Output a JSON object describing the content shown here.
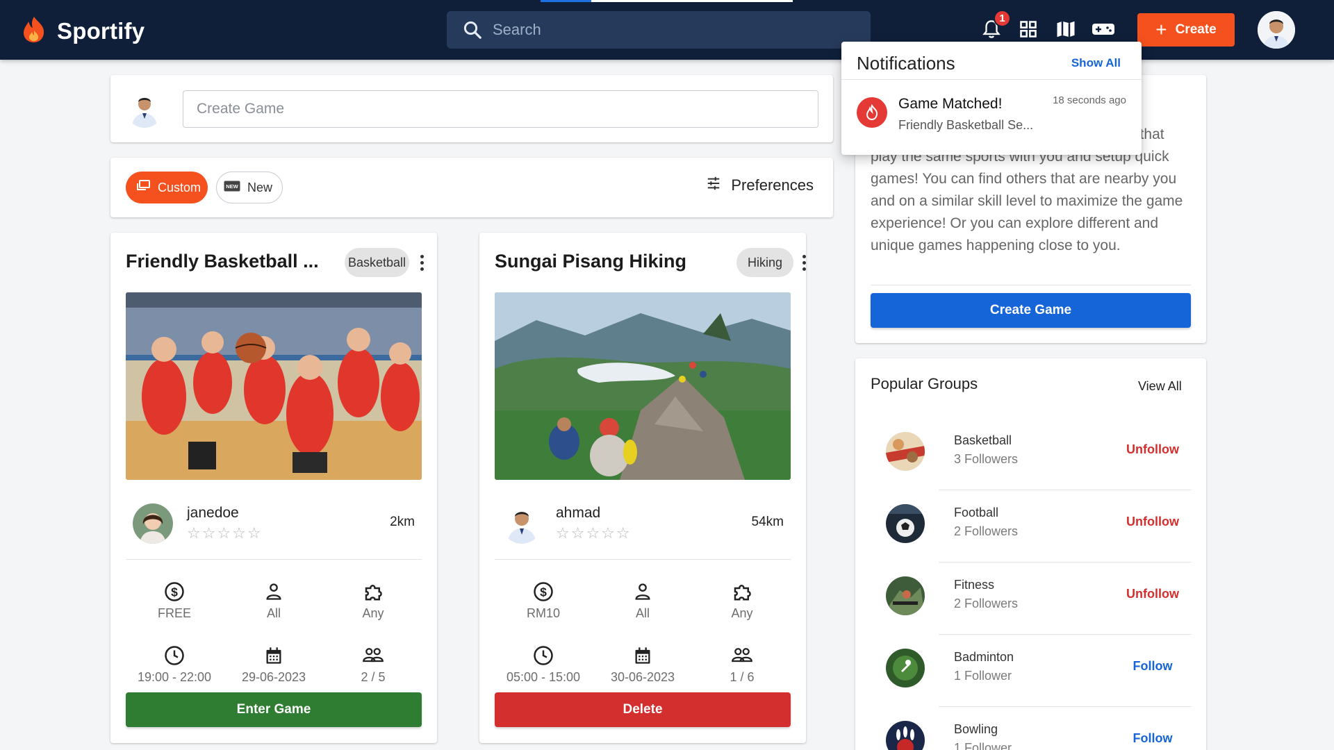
{
  "brand": {
    "name": "Sportify",
    "accent": "#f4511e",
    "navbar_color": "#0f1f3a"
  },
  "search": {
    "placeholder": "Search"
  },
  "topbar": {
    "notification_count": "1",
    "create_label": "Create",
    "icons": [
      "bell-icon",
      "apps-grid-icon",
      "map-icon",
      "gamepad-icon"
    ]
  },
  "creator": {
    "placeholder": "Create Game"
  },
  "filters": {
    "custom_label": "Custom",
    "new_label": "New",
    "preferences_label": "Preferences"
  },
  "games": [
    {
      "title": "Friendly Basketball ...",
      "tag": "Basketball",
      "host": "janedoe",
      "stars": "☆☆☆☆☆",
      "distance": "2km",
      "price": "FREE",
      "gender": "All",
      "skill": "Any",
      "time": "19:00 - 22:00",
      "date": "29-06-2023",
      "players": "2 / 5",
      "action_label": "Enter Game",
      "action_color": "#2e7d32"
    },
    {
      "title": "Sungai Pisang Hiking",
      "tag": "Hiking",
      "host": "ahmad",
      "stars": "☆☆☆☆☆",
      "distance": "54km",
      "price": "RM10",
      "gender": "All",
      "skill": "Any",
      "time": "05:00 - 15:00",
      "date": "30-06-2023",
      "players": "1 / 6",
      "action_label": "Delete",
      "action_color": "#d32f2f"
    }
  ],
  "about": {
    "text_partial": "g application where you can meet people that play the same sports with you and setup quick games! You can find others that are nearby you and on a similar skill level to maximize the game experience! Or you can explore different and unique games happening close to you.",
    "button_label": "Create Game"
  },
  "groups": {
    "title": "Popular Groups",
    "view_all": "View All",
    "items": [
      {
        "name": "Basketball",
        "followers": "3 Followers",
        "action": "Unfollow"
      },
      {
        "name": "Football",
        "followers": "2 Followers",
        "action": "Unfollow"
      },
      {
        "name": "Fitness",
        "followers": "2 Followers",
        "action": "Unfollow"
      },
      {
        "name": "Badminton",
        "followers": "1 Follower",
        "action": "Follow"
      },
      {
        "name": "Bowling",
        "followers": "1 Follower",
        "action": "Follow"
      }
    ]
  },
  "notifications": {
    "title": "Notifications",
    "show_all": "Show All",
    "items": [
      {
        "heading": "Game Matched!",
        "snippet": "Friendly Basketball Se...",
        "time": "18 seconds ago"
      }
    ]
  }
}
